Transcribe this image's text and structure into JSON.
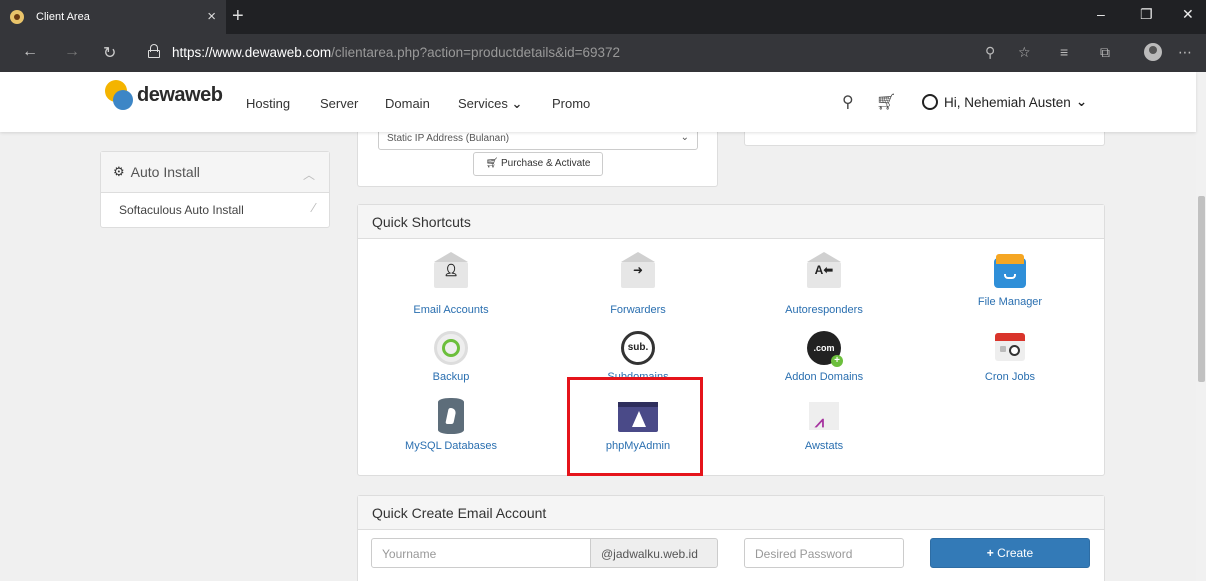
{
  "browser": {
    "tab_title": "Client Area",
    "tab_close": "×",
    "new_tab": "+",
    "url_host": "https://www.dewaweb.com",
    "url_path": "/clientarea.php?action=productdetails&id=69372",
    "window_controls": [
      "–",
      "❐",
      "✕"
    ]
  },
  "header": {
    "logo_text": "dewaweb",
    "nav": [
      "Hosting",
      "Server",
      "Domain",
      "Services",
      "Promo"
    ],
    "services_caret": "⌄",
    "user_greeting": "Hi, Nehemiah Austen"
  },
  "sidebar": {
    "title": "Auto Install",
    "items": [
      "Softaculous Auto Install"
    ]
  },
  "addon_panel": {
    "select_value": "Static IP Address (Bulanan)",
    "purchase_label": "Purchase & Activate"
  },
  "quick_shortcuts": {
    "title": "Quick Shortcuts",
    "items": [
      {
        "label": "Email Accounts",
        "icon": "email-accounts-icon"
      },
      {
        "label": "Forwarders",
        "icon": "forwarders-icon"
      },
      {
        "label": "Autoresponders",
        "icon": "autoresponders-icon"
      },
      {
        "label": "File Manager",
        "icon": "file-manager-icon"
      },
      {
        "label": "Backup",
        "icon": "backup-icon"
      },
      {
        "label": "Subdomains",
        "icon": "subdomains-icon"
      },
      {
        "label": "Addon Domains",
        "icon": "addon-domains-icon"
      },
      {
        "label": "Cron Jobs",
        "icon": "cron-jobs-icon"
      },
      {
        "label": "MySQL Databases",
        "icon": "mysql-databases-icon"
      },
      {
        "label": "phpMyAdmin",
        "icon": "phpmyadmin-icon"
      },
      {
        "label": "Awstats",
        "icon": "awstats-icon"
      }
    ],
    "icon_text": {
      "subdomains": "sub.",
      "addon": ".com"
    }
  },
  "quick_email": {
    "title": "Quick Create Email Account",
    "username_placeholder": "Yourname",
    "domain_suffix": "@jadwalku.web.id",
    "password_placeholder": "Desired Password",
    "create_label": "Create"
  },
  "colors": {
    "link": "#2a6fb0",
    "primary": "#337ab7",
    "highlight": "#e5141b"
  }
}
